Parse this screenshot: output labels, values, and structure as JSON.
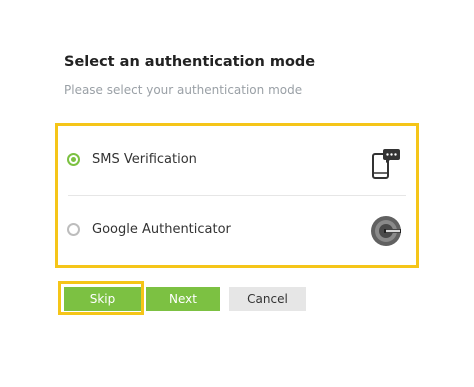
{
  "heading": {
    "title": "Select an authentication mode",
    "subtitle": "Please select your authentication mode"
  },
  "options": [
    {
      "label": "SMS Verification",
      "selected": true,
      "icon": "phone-sms-icon"
    },
    {
      "label": "Google Authenticator",
      "selected": false,
      "icon": "google-authenticator-icon"
    }
  ],
  "buttons": {
    "skip": "Skip",
    "next": "Next",
    "cancel": "Cancel"
  },
  "colors": {
    "accent": "#7cc142",
    "highlight": "#f5c518",
    "cancel_bg": "#e6e6e6"
  }
}
